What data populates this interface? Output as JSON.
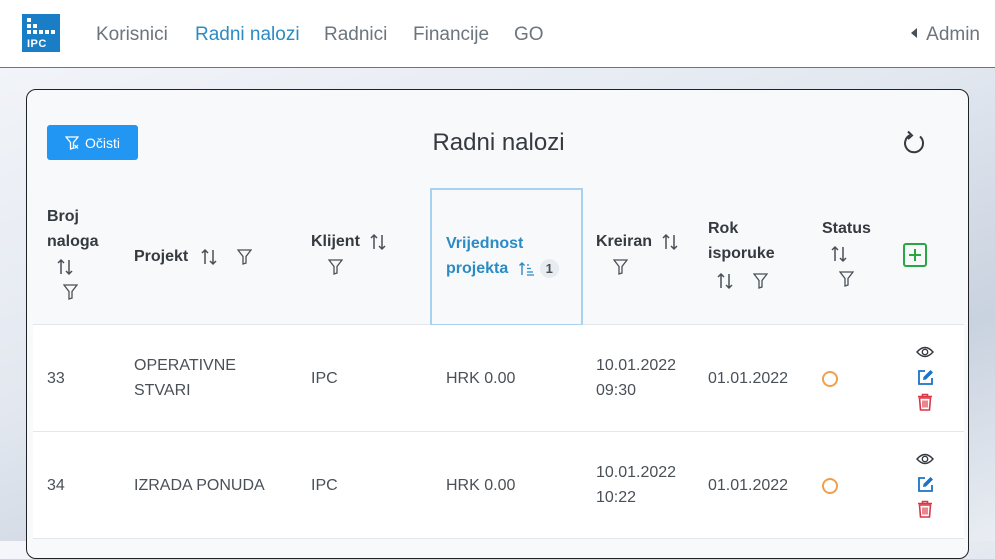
{
  "nav": {
    "logo_text": "IPC",
    "links": [
      "Korisnici",
      "Radni nalozi",
      "Radnici",
      "Financije",
      "GO"
    ],
    "active": "Radni nalozi",
    "user": "Admin"
  },
  "page": {
    "title": "Radni nalozi",
    "clear_label": "Očisti"
  },
  "table": {
    "headers": {
      "broj_line1": "Broj",
      "broj_line2": "naloga",
      "projekt": "Projekt",
      "klijent": "Klijent",
      "vrijednost_line1": "Vrijednost",
      "vrijednost_line2": "projekta",
      "sort_order_badge": "1",
      "kreiran": "Kreiran",
      "rok_line1": "Rok",
      "rok_line2": "isporuke",
      "status": "Status"
    },
    "rows": [
      {
        "broj": "33",
        "projekt_line1": "OPERATIVNE",
        "projekt_line2": "STVARI",
        "klijent": "IPC",
        "vrijednost": "HRK 0.00",
        "kreiran_date": "10.01.2022",
        "kreiran_time": "09:30",
        "rok": "01.01.2022"
      },
      {
        "broj": "34",
        "projekt_line1": "IZRADA PONUDA",
        "projekt_line2": "",
        "klijent": "IPC",
        "vrijednost": "HRK 0.00",
        "kreiran_date": "10.01.2022",
        "kreiran_time": "10:22",
        "rok": "01.01.2022"
      }
    ]
  },
  "colors": {
    "accent": "#2b8bc4",
    "primary_button": "#2196f3",
    "add": "#28a745",
    "delete": "#dc3545",
    "edit": "#1a73c8",
    "status_pending": "#f0a04b"
  },
  "icons": [
    "filter-clear-icon",
    "refresh-icon",
    "sort-icon",
    "sort-ascending-icon",
    "filter-icon",
    "add-icon",
    "view-eye-icon",
    "edit-icon",
    "delete-trash-icon",
    "status-circle-icon"
  ]
}
